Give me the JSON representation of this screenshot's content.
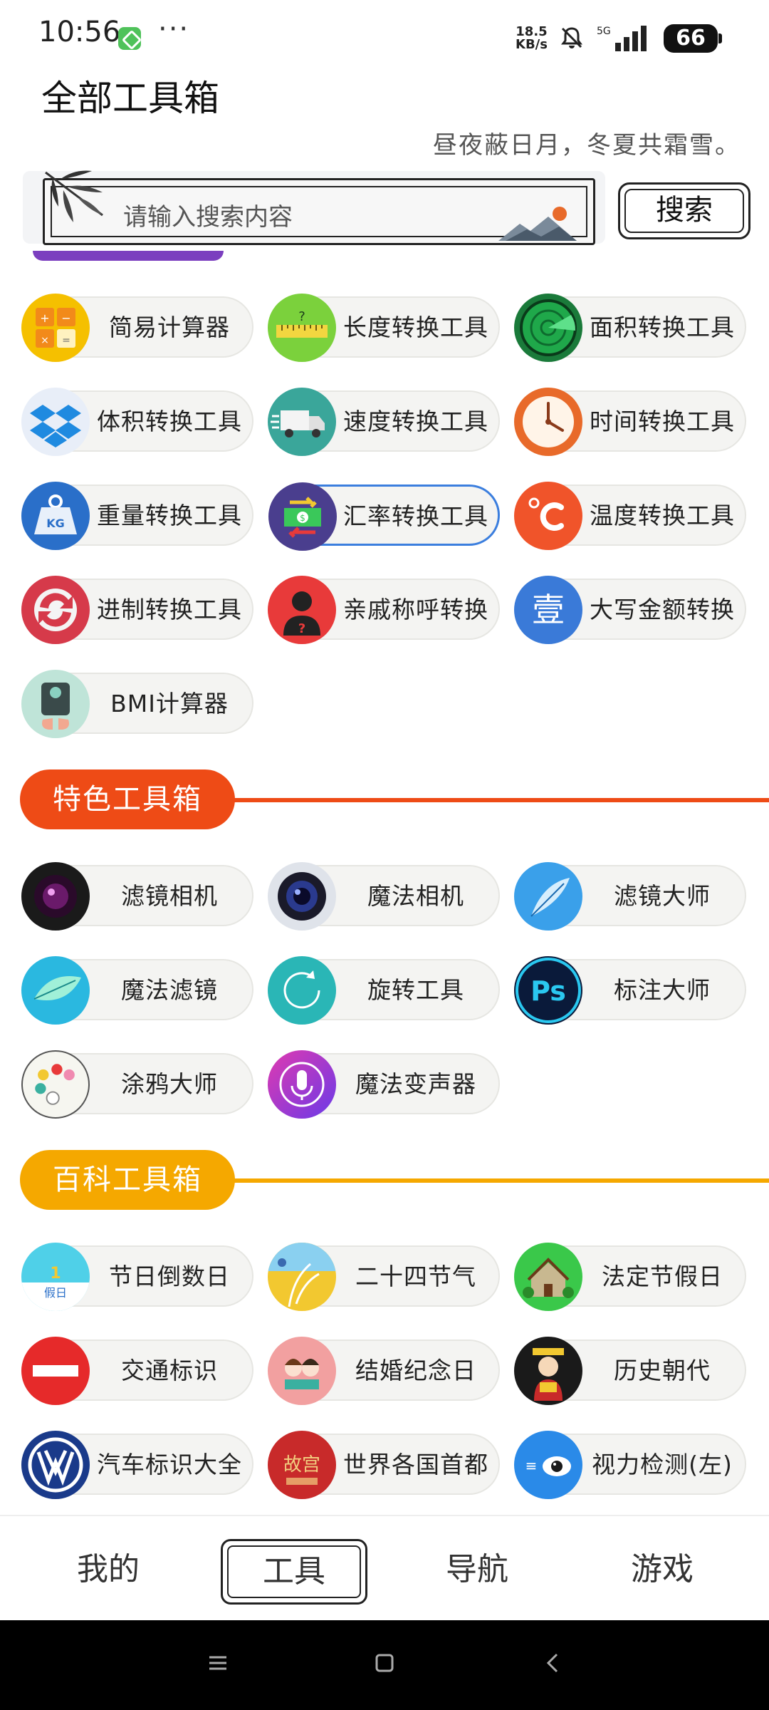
{
  "status": {
    "time": "10:56",
    "dots": "···",
    "speed_top": "18.5",
    "speed_bottom": "KB/s",
    "network": "5G",
    "battery": "66"
  },
  "header": {
    "title": "全部工具箱",
    "motto": "昼夜蔽日月，冬夏共霜雪。"
  },
  "search": {
    "placeholder": "请输入搜索内容",
    "button": "搜索"
  },
  "converters": [
    {
      "label": "简易计算器",
      "icon": "calculator-icon",
      "color": "#f5c000"
    },
    {
      "label": "长度转换工具",
      "icon": "ruler-icon",
      "color": "#7bd13c"
    },
    {
      "label": "面积转换工具",
      "icon": "radar-icon",
      "color": "#1a7a3a"
    },
    {
      "label": "体积转换工具",
      "icon": "dropbox-icon",
      "color": "#e8eef8"
    },
    {
      "label": "速度转换工具",
      "icon": "truck-icon",
      "color": "#3aa69a"
    },
    {
      "label": "时间转换工具",
      "icon": "clock-icon",
      "color": "#e86a2a"
    },
    {
      "label": "重量转换工具",
      "icon": "weight-icon",
      "color": "#2a6fc9"
    },
    {
      "label": "汇率转换工具",
      "icon": "exchange-icon",
      "color": "#4a3e8e"
    },
    {
      "label": "温度转换工具",
      "icon": "celsius-icon",
      "color": "#f0542a"
    },
    {
      "label": "进制转换工具",
      "icon": "cycle-icon",
      "color": "#d63a4a"
    },
    {
      "label": "亲戚称呼转换",
      "icon": "person-question-icon",
      "color": "#e83a3a"
    },
    {
      "label": "大写金额转换",
      "icon": "chinese-number-icon",
      "color": "#3a7ad8"
    },
    {
      "label": "BMI计算器",
      "icon": "scale-icon",
      "color": "#bfe4d8"
    }
  ],
  "featured_section": {
    "title": "特色工具箱",
    "color": "#ee4b16"
  },
  "featured": [
    {
      "label": "滤镜相机",
      "icon": "camera-lens-icon",
      "color": "#1a1a1a"
    },
    {
      "label": "魔法相机",
      "icon": "camera-icon",
      "color": "#2a3a6e"
    },
    {
      "label": "滤镜大师",
      "icon": "feather-icon",
      "color": "#3aa0ea"
    },
    {
      "label": "魔法滤镜",
      "icon": "leaf-icon",
      "color": "#2ab8e0"
    },
    {
      "label": "旋转工具",
      "icon": "rotate-icon",
      "color": "#2ab6b6"
    },
    {
      "label": "标注大师",
      "icon": "ps-icon",
      "color": "#0a1a3a"
    },
    {
      "label": "涂鸦大师",
      "icon": "palette-icon",
      "color": "#f6f6f0"
    },
    {
      "label": "魔法变声器",
      "icon": "microphone-icon",
      "color": "#8a3ae0"
    }
  ],
  "encyclopedia_section": {
    "title": "百科工具箱",
    "color": "#f5a800"
  },
  "encyclopedia": [
    {
      "label": "节日倒数日",
      "icon": "holiday-icon",
      "color": "#4fd0e8"
    },
    {
      "label": "二十四节气",
      "icon": "wheat-icon",
      "color": "#f2c830"
    },
    {
      "label": "法定节假日",
      "icon": "house-icon",
      "color": "#3ac84a"
    },
    {
      "label": "交通标识",
      "icon": "no-entry-icon",
      "color": "#e62a2a"
    },
    {
      "label": "结婚纪念日",
      "icon": "couple-icon",
      "color": "#f2a0a0"
    },
    {
      "label": "历史朝代",
      "icon": "emperor-icon",
      "color": "#1a1a1a"
    },
    {
      "label": "汽车标识大全",
      "icon": "vw-logo-icon",
      "color": "#1a3a8a"
    },
    {
      "label": "世界各国首都",
      "icon": "palace-icon",
      "color": "#c82a2a"
    },
    {
      "label": "视力检测(左)",
      "icon": "eye-icon",
      "color": "#2a8ae8"
    }
  ],
  "tabs": [
    {
      "label": "我的"
    },
    {
      "label": "工具"
    },
    {
      "label": "导航"
    },
    {
      "label": "游戏"
    }
  ]
}
